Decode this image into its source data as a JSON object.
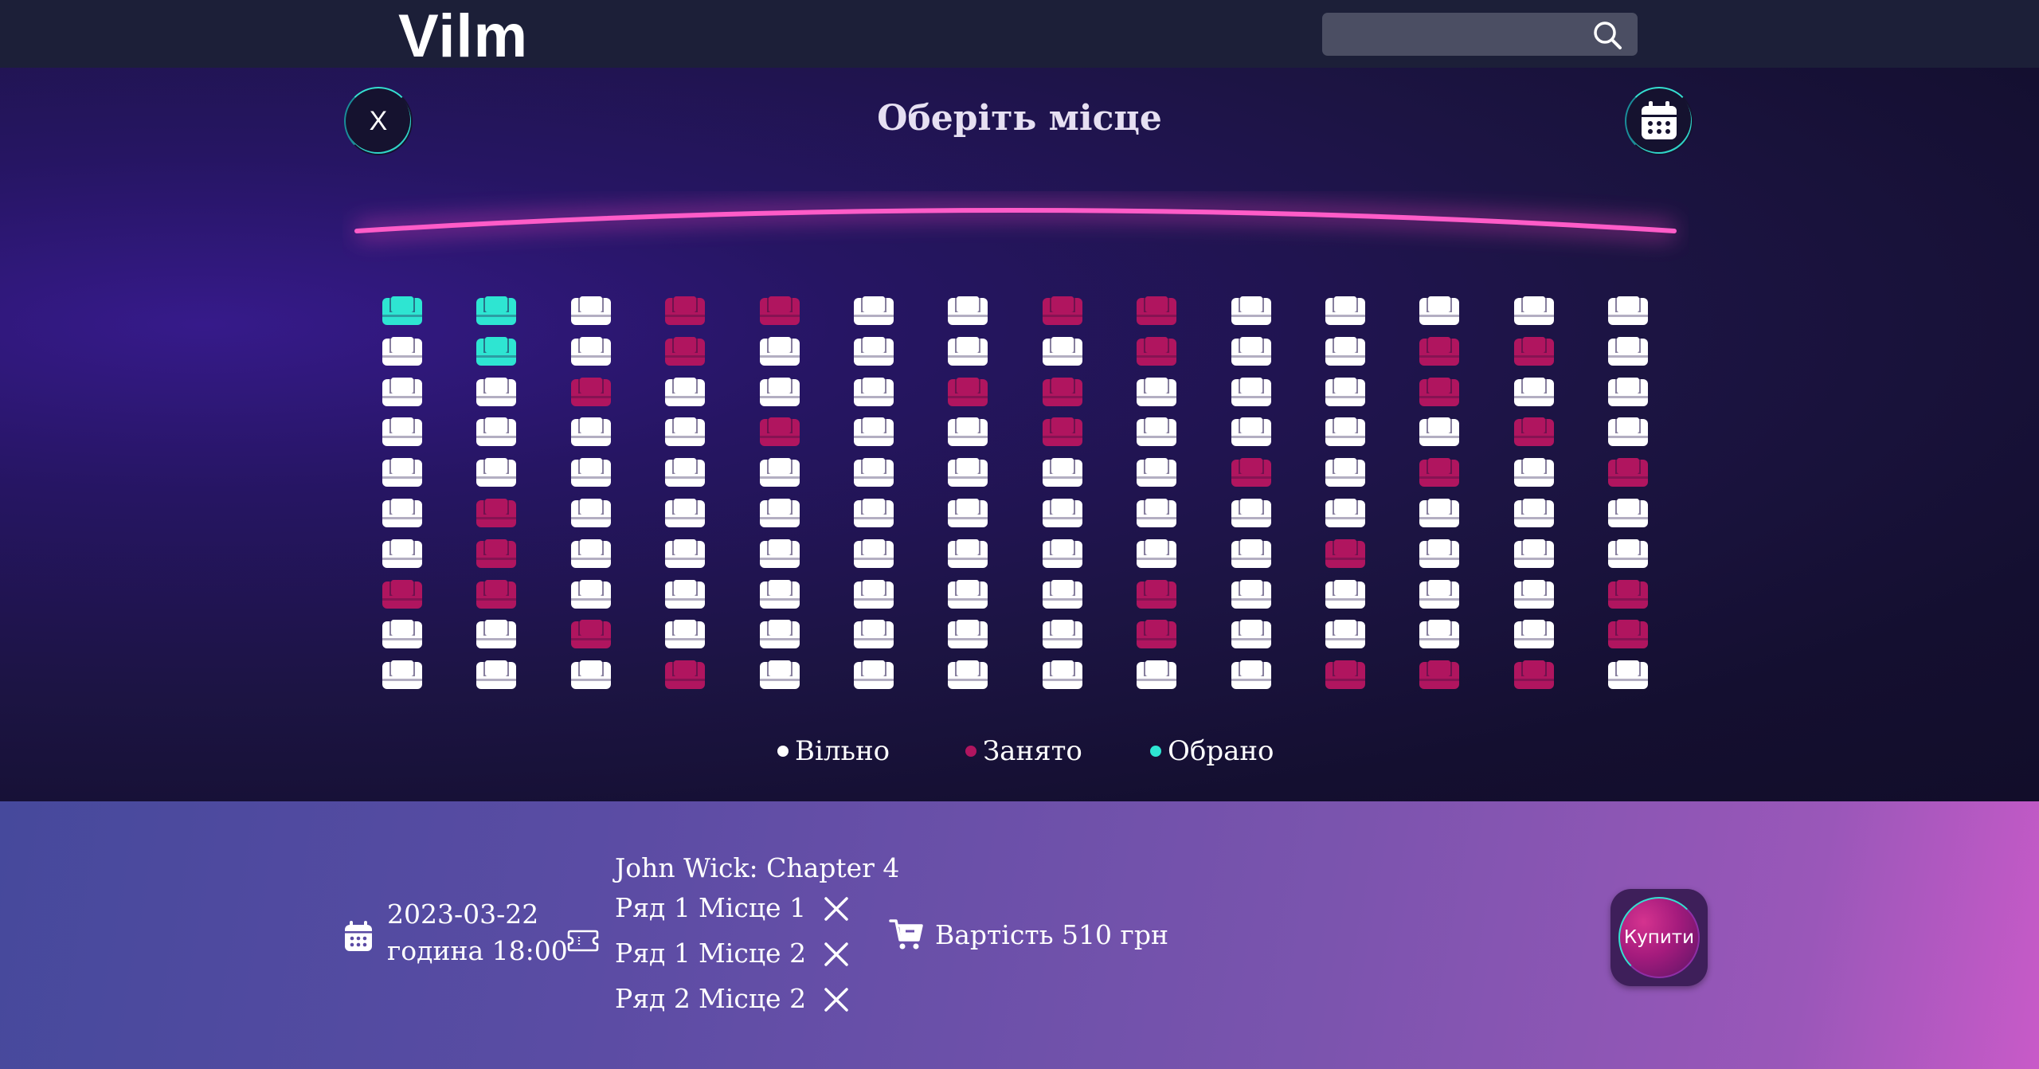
{
  "header": {
    "logo": "Vilm",
    "search": {
      "placeholder": "",
      "value": ""
    }
  },
  "hall": {
    "title": "Оберіть місце",
    "close_label": "X",
    "seat_status_colors": {
      "free": "#ffffff",
      "taken": "#b0155f",
      "selected": "#2ee5d2"
    },
    "rows": [
      [
        "selected",
        "selected",
        "free",
        "taken",
        "taken",
        "free",
        "free",
        "taken",
        "taken",
        "free",
        "free",
        "free",
        "free",
        "free"
      ],
      [
        "free",
        "selected",
        "free",
        "taken",
        "free",
        "free",
        "free",
        "free",
        "taken",
        "free",
        "free",
        "taken",
        "taken",
        "free"
      ],
      [
        "free",
        "free",
        "taken",
        "free",
        "free",
        "free",
        "taken",
        "taken",
        "free",
        "free",
        "free",
        "taken",
        "free",
        "free"
      ],
      [
        "free",
        "free",
        "free",
        "free",
        "taken",
        "free",
        "free",
        "taken",
        "free",
        "free",
        "free",
        "free",
        "taken",
        "free"
      ],
      [
        "free",
        "free",
        "free",
        "free",
        "free",
        "free",
        "free",
        "free",
        "free",
        "taken",
        "free",
        "taken",
        "free",
        "taken"
      ],
      [
        "free",
        "taken",
        "free",
        "free",
        "free",
        "free",
        "free",
        "free",
        "free",
        "free",
        "free",
        "free",
        "free",
        "free"
      ],
      [
        "free",
        "taken",
        "free",
        "free",
        "free",
        "free",
        "free",
        "free",
        "free",
        "free",
        "taken",
        "free",
        "free",
        "free"
      ],
      [
        "taken",
        "taken",
        "free",
        "free",
        "free",
        "free",
        "free",
        "free",
        "taken",
        "free",
        "free",
        "free",
        "free",
        "taken"
      ],
      [
        "free",
        "free",
        "taken",
        "free",
        "free",
        "free",
        "free",
        "free",
        "taken",
        "free",
        "free",
        "free",
        "free",
        "taken"
      ],
      [
        "free",
        "free",
        "free",
        "taken",
        "free",
        "free",
        "free",
        "free",
        "free",
        "free",
        "taken",
        "taken",
        "taken",
        "free"
      ]
    ],
    "legend": [
      {
        "label": "Вільно",
        "color": "#ffffff"
      },
      {
        "label": "Занято",
        "color": "#b0155f"
      },
      {
        "label": "Обрано",
        "color": "#2ee5d2"
      }
    ]
  },
  "order": {
    "date": "2023-03-22",
    "time": "година 18:00",
    "movie": "John Wick: Chapter 4",
    "tickets": [
      {
        "row": "Ряд 1",
        "seat": "Місце 1"
      },
      {
        "row": "Ряд 1",
        "seat": "Місце 2"
      },
      {
        "row": "Ряд 2",
        "seat": "Місце 2"
      }
    ],
    "price": "Вартість 510 грн",
    "buy_label": "Купити"
  }
}
